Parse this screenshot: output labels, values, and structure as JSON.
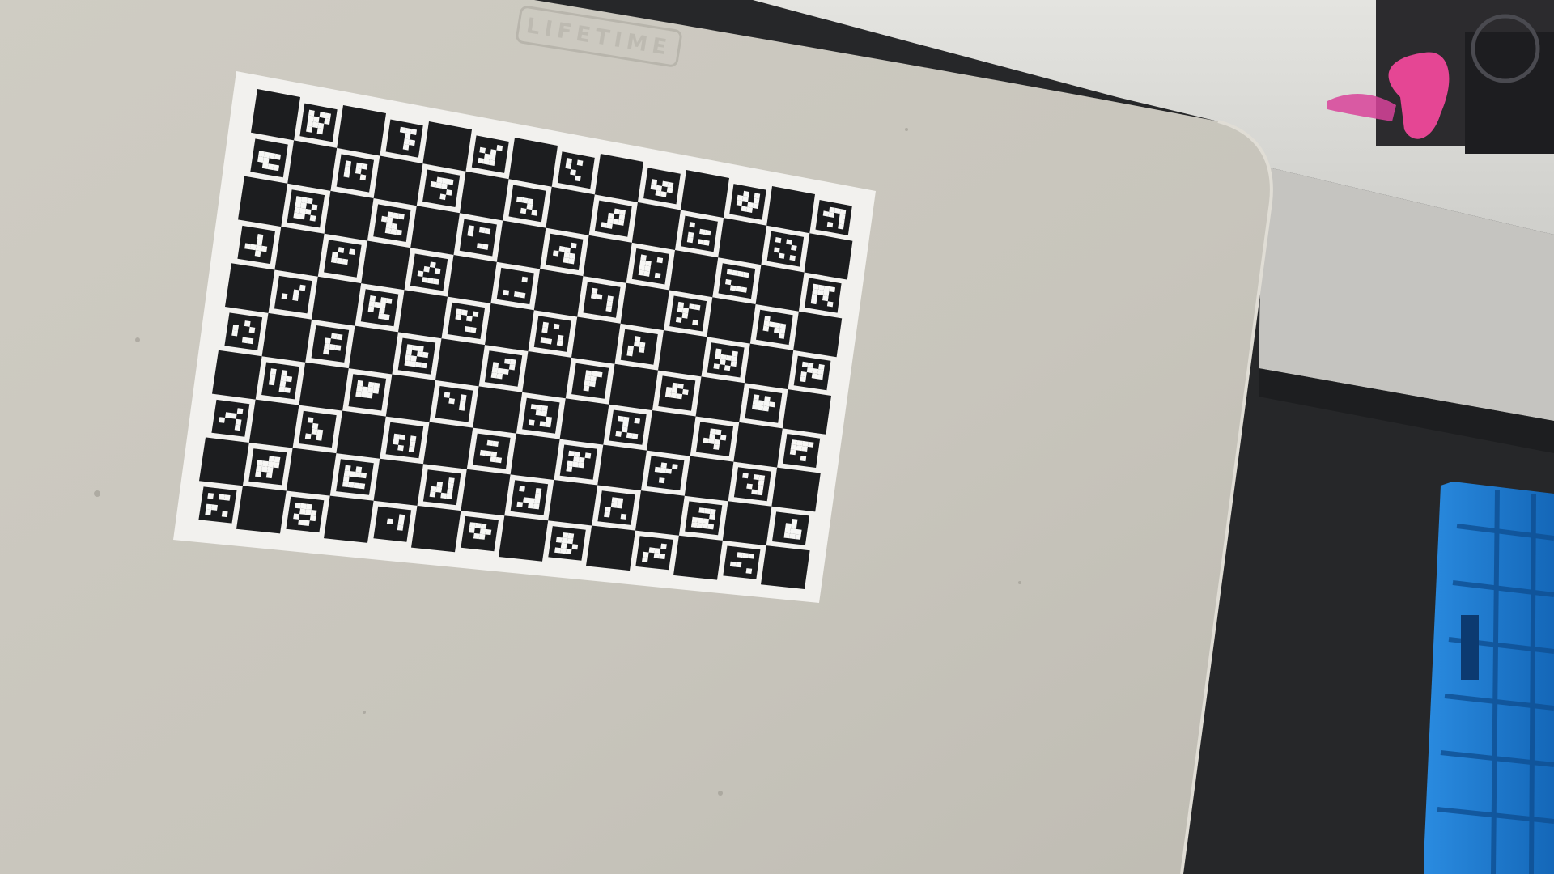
{
  "scene": {
    "description_label": "",
    "table_logo_text": "LIFETIME",
    "colors": {
      "floor": "#27282a",
      "table_top": "#c9c6bd",
      "table_shadow": "#a9a69d",
      "shelf_top": "#dcdcd8",
      "shelf_face": "#c4c3bf",
      "board_paper": "#f2f1ee",
      "board_dark": "#1c1d1f",
      "marker_white": "#f7f7f5",
      "bin_blue": "#1c7fd4",
      "bag_pink": "#e64595"
    },
    "calibration_board": {
      "type": "ChArUco",
      "columns": 14,
      "rows": 10
    }
  }
}
